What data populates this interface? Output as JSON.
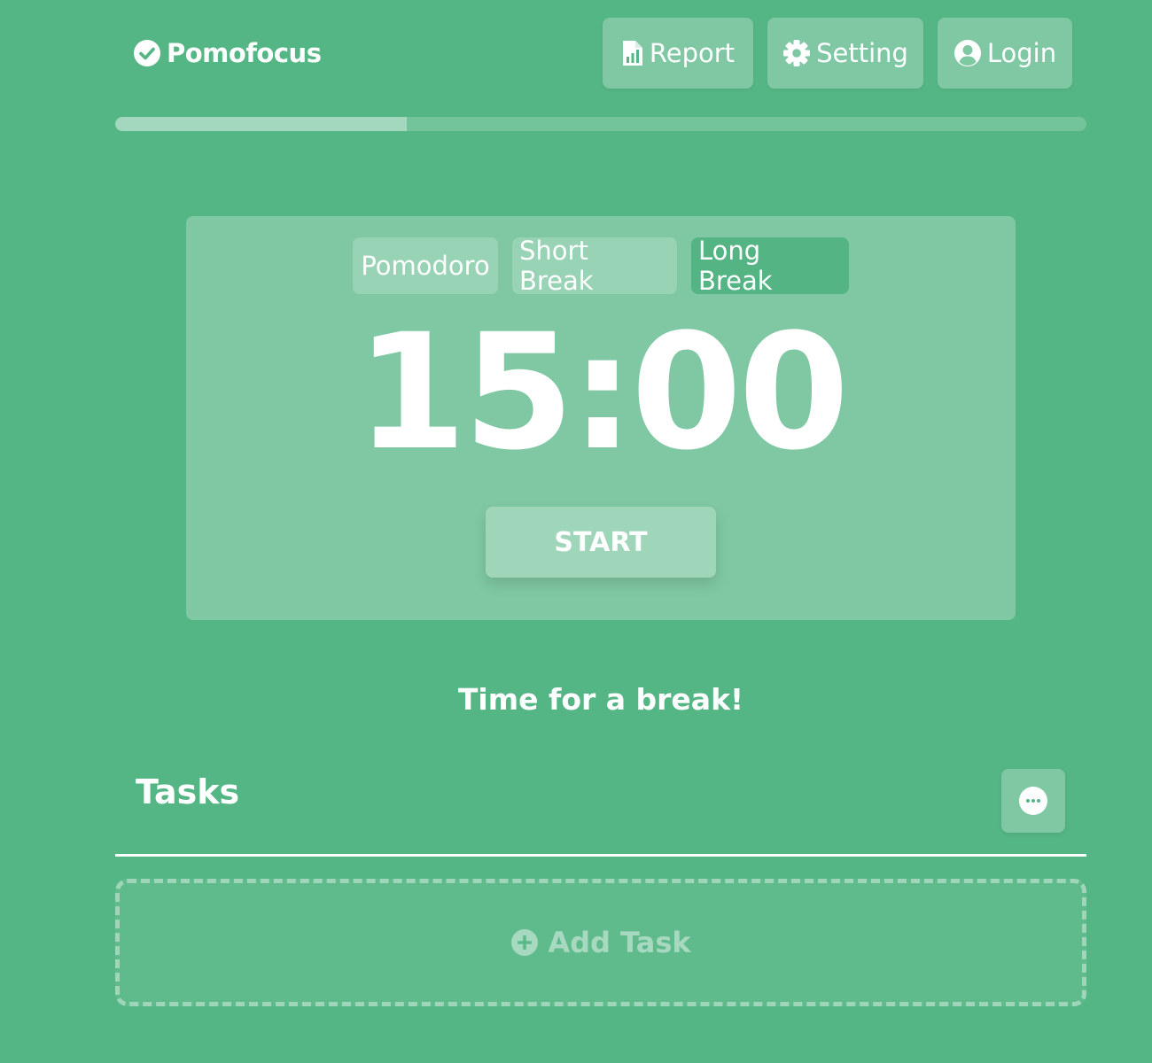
{
  "app": {
    "name": "Pomofocus"
  },
  "header": {
    "report_label": "Report",
    "setting_label": "Setting",
    "login_label": "Login"
  },
  "progress": {
    "fraction": 0.3
  },
  "timer": {
    "tabs": [
      {
        "label": "Pomodoro",
        "active": false
      },
      {
        "label": "Short Break",
        "active": false
      },
      {
        "label": "Long Break",
        "active": true
      }
    ],
    "time": "15:00",
    "start_label": "START"
  },
  "message": "Time for a break!",
  "tasks": {
    "title": "Tasks",
    "add_label": "Add Task"
  },
  "colors": {
    "background": "#55b685",
    "active_tab": "#54b484",
    "text": "#ffffff"
  },
  "icons": {
    "logo": "check-circle-icon",
    "report": "report-chart-icon",
    "setting": "gear-icon",
    "login": "user-circle-icon",
    "tasks_menu": "more-dots-icon",
    "add_task": "plus-circle-icon"
  }
}
